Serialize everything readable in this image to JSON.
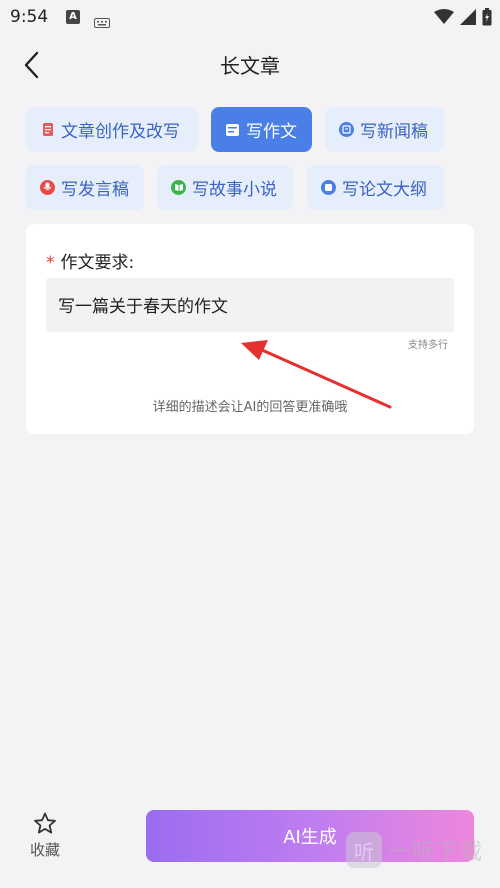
{
  "status_bar": {
    "time": "9:54",
    "a_label": "A"
  },
  "header": {
    "title": "长文章"
  },
  "chips": [
    {
      "label": "文章创作及改写",
      "icon": "document-icon",
      "color": "#e85a5a"
    },
    {
      "label": "写作文",
      "icon": "essay-icon",
      "color": "#ffffff",
      "active": true
    },
    {
      "label": "写新闻稿",
      "icon": "news-icon",
      "color": "#4b7fe8"
    },
    {
      "label": "写发言稿",
      "icon": "microphone-icon",
      "color": "#e84a4a"
    },
    {
      "label": "写故事小说",
      "icon": "book-icon",
      "color": "#3bb54a"
    },
    {
      "label": "写论文大纲",
      "icon": "outline-icon",
      "color": "#4b7fe8"
    }
  ],
  "form": {
    "required_mark": "*",
    "label": "作文要求:",
    "input_value": "写一篇关于春天的作文",
    "multi_line_hint": "支持多行",
    "description_hint": "详细的描述会让AI的回答更准确哦"
  },
  "bottom": {
    "favorite_label": "收藏",
    "generate_label": "AI生成"
  },
  "watermark": {
    "badge": "听",
    "text": "一听下载"
  }
}
